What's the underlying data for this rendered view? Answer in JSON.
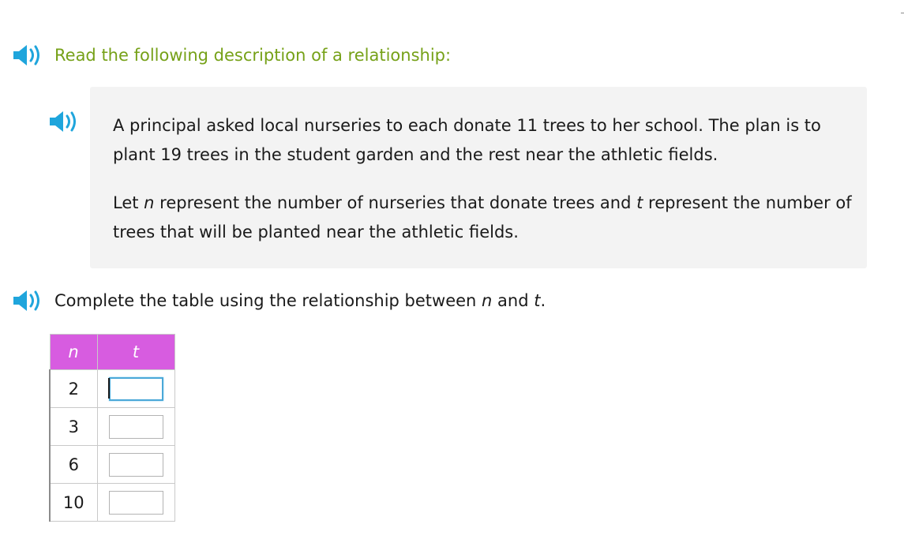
{
  "instructions": {
    "read": "Read the following description of a relationship:",
    "complete_prefix": "Complete the table using the relationship between ",
    "complete_var1": "n",
    "complete_mid": " and ",
    "complete_var2": "t",
    "complete_suffix": "."
  },
  "description": {
    "paragraph1": "A principal asked local nurseries to each donate 11 trees to her school. The plan is to plant 19 trees in the student garden and the rest near the athletic fields.",
    "p2_let": "Let ",
    "p2_var1": "n",
    "p2_mid": " represent the number of nurseries that donate trees and ",
    "p2_var2": "t",
    "p2_end": " represent the number of trees that will be planted near the athletic fields."
  },
  "table": {
    "headers": [
      "n",
      "t"
    ],
    "rows": [
      {
        "n": "2",
        "t": ""
      },
      {
        "n": "3",
        "t": ""
      },
      {
        "n": "6",
        "t": ""
      },
      {
        "n": "10",
        "t": ""
      }
    ]
  },
  "icons": {
    "speaker": "speaker-icon"
  },
  "colors": {
    "speaker": "#1fa5dc",
    "instruction_green": "#76a118",
    "table_header": "#d75ce0",
    "description_background": "#f3f3f3",
    "input_focus": "#4aa8d8"
  }
}
